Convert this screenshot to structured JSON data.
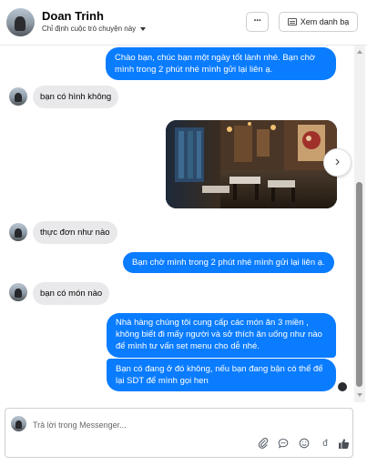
{
  "header": {
    "name": "Doan Trinh",
    "subtitle": "Chỉ định cuộc trò chuyện này",
    "more_label": "···",
    "list_button_label": "Xem danh bạ"
  },
  "messages": [
    {
      "from": "page",
      "text": "Chào bạn, chúc bạn một ngày tốt lành nhé. Bạn chờ mình trong 2 phút nhé mình gửi lại liên ạ."
    },
    {
      "from": "user",
      "text": "bạn có hình không"
    },
    {
      "from": "page",
      "type": "image",
      "alt": "restaurant photo"
    },
    {
      "from": "user",
      "text": "thực đơn như nào"
    },
    {
      "from": "page",
      "text": "Bạn chờ mình trong 2 phút nhé mình gửi lại liên ạ."
    },
    {
      "from": "user",
      "text": "bạn có món nào"
    },
    {
      "from": "page",
      "text": "Nhà hàng chúng tôi cung cấp các món ăn 3 miền , không biết đi mấy người và sở thích ăn uống như nào để mình tư vấn set menu cho dễ nhé."
    },
    {
      "from": "page",
      "text": "Bạn có đang ở đó không, nếu bạn đang bận có thể để lại SDT để mình gọi hen"
    }
  ],
  "composer": {
    "placeholder": "Trả lời trong Messenger...",
    "icons": [
      "paperclip-icon",
      "chat-icon",
      "emoji-icon",
      "currency-icon",
      "like-icon"
    ]
  },
  "colors": {
    "outgoing_bubble": "#0a7cff",
    "incoming_bubble": "#e9e9eb"
  }
}
